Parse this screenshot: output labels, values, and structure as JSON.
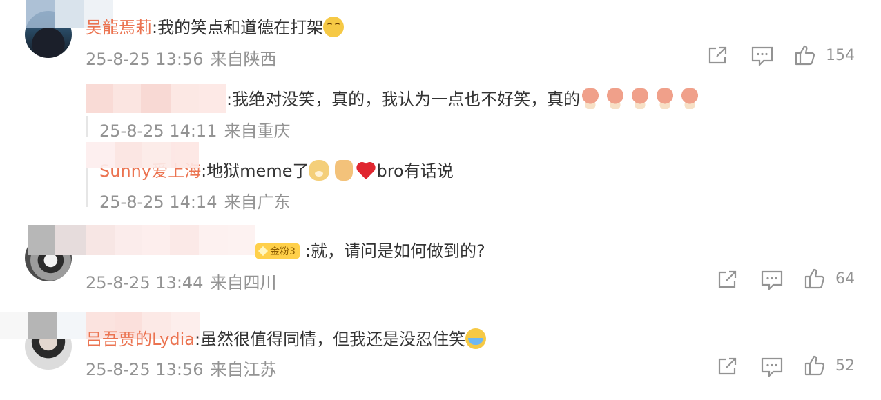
{
  "comments": [
    {
      "username": "吴龍焉莉",
      "text": "我的笑点和道德在打架",
      "emoji": "laugh-cry-icon",
      "date": "25-8-25 13:56",
      "location": "来自陕西",
      "likes": "154",
      "replies": [
        {
          "username": "",
          "text": "我绝对没笑，真的，我认为一点也不好笑，真的",
          "emojis": [
            "mushroom-icon",
            "mushroom-icon",
            "mushroom-icon",
            "mushroom-icon",
            "mushroom-icon"
          ],
          "date": "25-8-25 14:11",
          "location": "来自重庆"
        },
        {
          "username": "Sunny爱上海",
          "text": "地狱meme了",
          "text2": "bro有话说",
          "date": "25-8-25 14:14",
          "location": "来自广东"
        }
      ]
    },
    {
      "username": "",
      "badge": "金粉3",
      "text": "就，请问是如何做到的?",
      "date": "25-8-25 13:44",
      "location": "来自四川",
      "likes": "64"
    },
    {
      "username": "吕吾贾的Lydia",
      "text": "虽然很值得同情，但我还是没忍住笑",
      "date": "25-8-25 13:56",
      "location": "来自江苏",
      "likes": "52"
    }
  ],
  "colors": {
    "username": "#eb7350",
    "meta": "#939393",
    "text": "#333333",
    "badge": "#ffd04a"
  }
}
